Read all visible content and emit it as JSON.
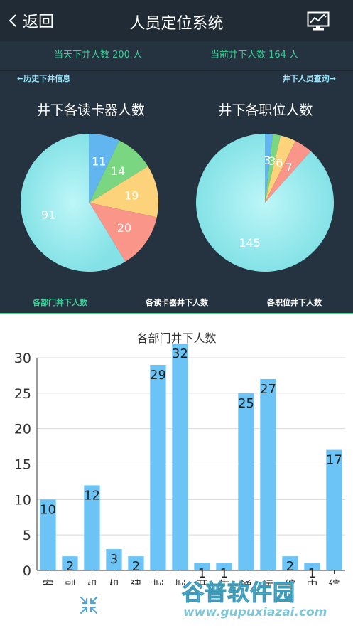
{
  "header": {
    "back_label": "返回",
    "title": "人员定位系统",
    "back_icon": "chevron-left-icon",
    "monitor_icon": "monitor-chart-icon"
  },
  "stats": {
    "today_label": "当天下井人数 200 人",
    "current_label": "当前井下人数 164 人"
  },
  "nav": {
    "history_label": "←历史下井信息",
    "query_label": "井下人员查询→"
  },
  "tabs": {
    "dept_label": "各部门井下人数",
    "reader_label": "各读卡器井下人数",
    "job_label": "各职位井下人数"
  },
  "shrink_icon": "shrink-arrows-icon",
  "watermark": {
    "main": "谷普软件园",
    "url": "www.gupuxiazai.com"
  },
  "chart_data": [
    {
      "type": "pie",
      "title": "井下各读卡器人数",
      "values": [
        11,
        14,
        19,
        20,
        91
      ],
      "labels": [
        "11",
        "14",
        "19",
        "20",
        "91"
      ],
      "colors": [
        "#62b6f0",
        "#7ad680",
        "#fcd37a",
        "#fa958a",
        "#8fe9ea"
      ]
    },
    {
      "type": "pie",
      "title": "井下各职位人数",
      "values": [
        3,
        3,
        6,
        7,
        145
      ],
      "labels": [
        "3",
        "3",
        "6",
        "7",
        "145"
      ],
      "colors": [
        "#62b6f0",
        "#7ad680",
        "#fcd37a",
        "#fa958a",
        "#8fe9ea"
      ]
    },
    {
      "type": "bar",
      "title": "各部门井下人数",
      "categories": [
        "安",
        "副",
        "机",
        "机",
        "建",
        "掘",
        "掘",
        "开",
        "生",
        "通",
        "运",
        "综",
        "中",
        "综"
      ],
      "values": [
        10,
        2,
        12,
        3,
        2,
        29,
        32,
        1,
        1,
        25,
        27,
        2,
        1,
        17
      ],
      "ylim": [
        0,
        30
      ],
      "yticks": [
        0,
        5,
        10,
        15,
        20,
        25,
        30
      ],
      "bar_color": "#6cc3f5",
      "grid": true
    }
  ]
}
